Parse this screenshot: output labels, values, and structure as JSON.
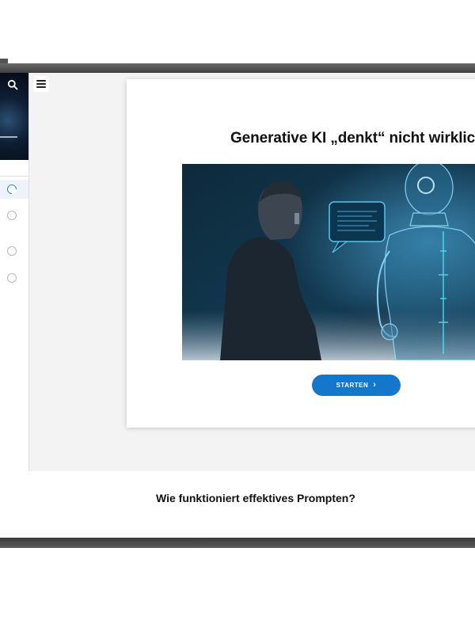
{
  "sidebar": {
    "search_icon": "search-icon",
    "lessons": [
      {
        "state": "in-progress"
      },
      {
        "state": "not-started"
      },
      {
        "state": "not-started"
      },
      {
        "state": "not-started"
      }
    ]
  },
  "header": {
    "menu_icon": "hamburger-menu-icon"
  },
  "lesson_card": {
    "title": "Generative KI „denkt“ nicht wirklich",
    "image": "person-facing-holographic-robot",
    "start_label": "STARTEN",
    "start_icon": "chevron-right-icon"
  },
  "next_section": {
    "title": "Wie funktioniert effektives Prompten?"
  },
  "colors": {
    "accent": "#1477cc",
    "frame": "#4a4a4a",
    "background": "#f3f3f3"
  }
}
